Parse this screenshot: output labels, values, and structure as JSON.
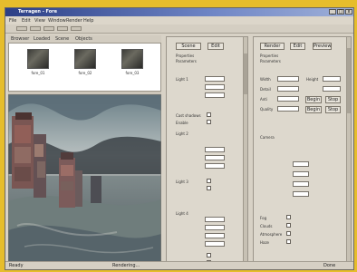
{
  "window": {
    "title": "Terragen - Fore",
    "controls": [
      "_",
      "□",
      "x"
    ]
  },
  "menu": [
    "File",
    "Edit",
    "View",
    "Window",
    "Render",
    "Help"
  ],
  "left": {
    "tabs": [
      "Browser",
      "Loaded",
      "Scene",
      "Objects"
    ],
    "thumbnails": [
      {
        "label": "fore_01"
      },
      {
        "label": "fore_02"
      },
      {
        "label": "fore_03"
      }
    ]
  },
  "mid_panel": {
    "top_buttons": [
      "Scene",
      "Edit"
    ],
    "heading": "Properties",
    "subheading": "Parameters",
    "rows": [
      "Light 1",
      "Light 2",
      "Light 3",
      "Light 4"
    ],
    "checks": [
      "Cast shadows",
      "Enable"
    ]
  },
  "right_panel": {
    "top_buttons": [
      "Render",
      "Edit",
      "Preview"
    ],
    "heading": "Properties",
    "subheading": "Parameters",
    "rows": [
      "Width",
      "Height",
      "Detail",
      "Anti",
      "Quality"
    ],
    "buttons": [
      "Begin",
      "Stop",
      "Begin",
      "Stop"
    ],
    "section2": "Camera",
    "checks": [
      "Fog",
      "Clouds",
      "Atmosphere",
      "Haze"
    ]
  },
  "status": {
    "left": "Ready",
    "middle": "Rendering...",
    "right": "Done"
  },
  "colors": {
    "background": "#e6bd2c",
    "titlebar": "#2c3f86",
    "panel": "#ddd8cd"
  },
  "icons": [
    "minimize-icon",
    "maximize-icon",
    "close-icon",
    "scene-thumbnail-icon"
  ]
}
